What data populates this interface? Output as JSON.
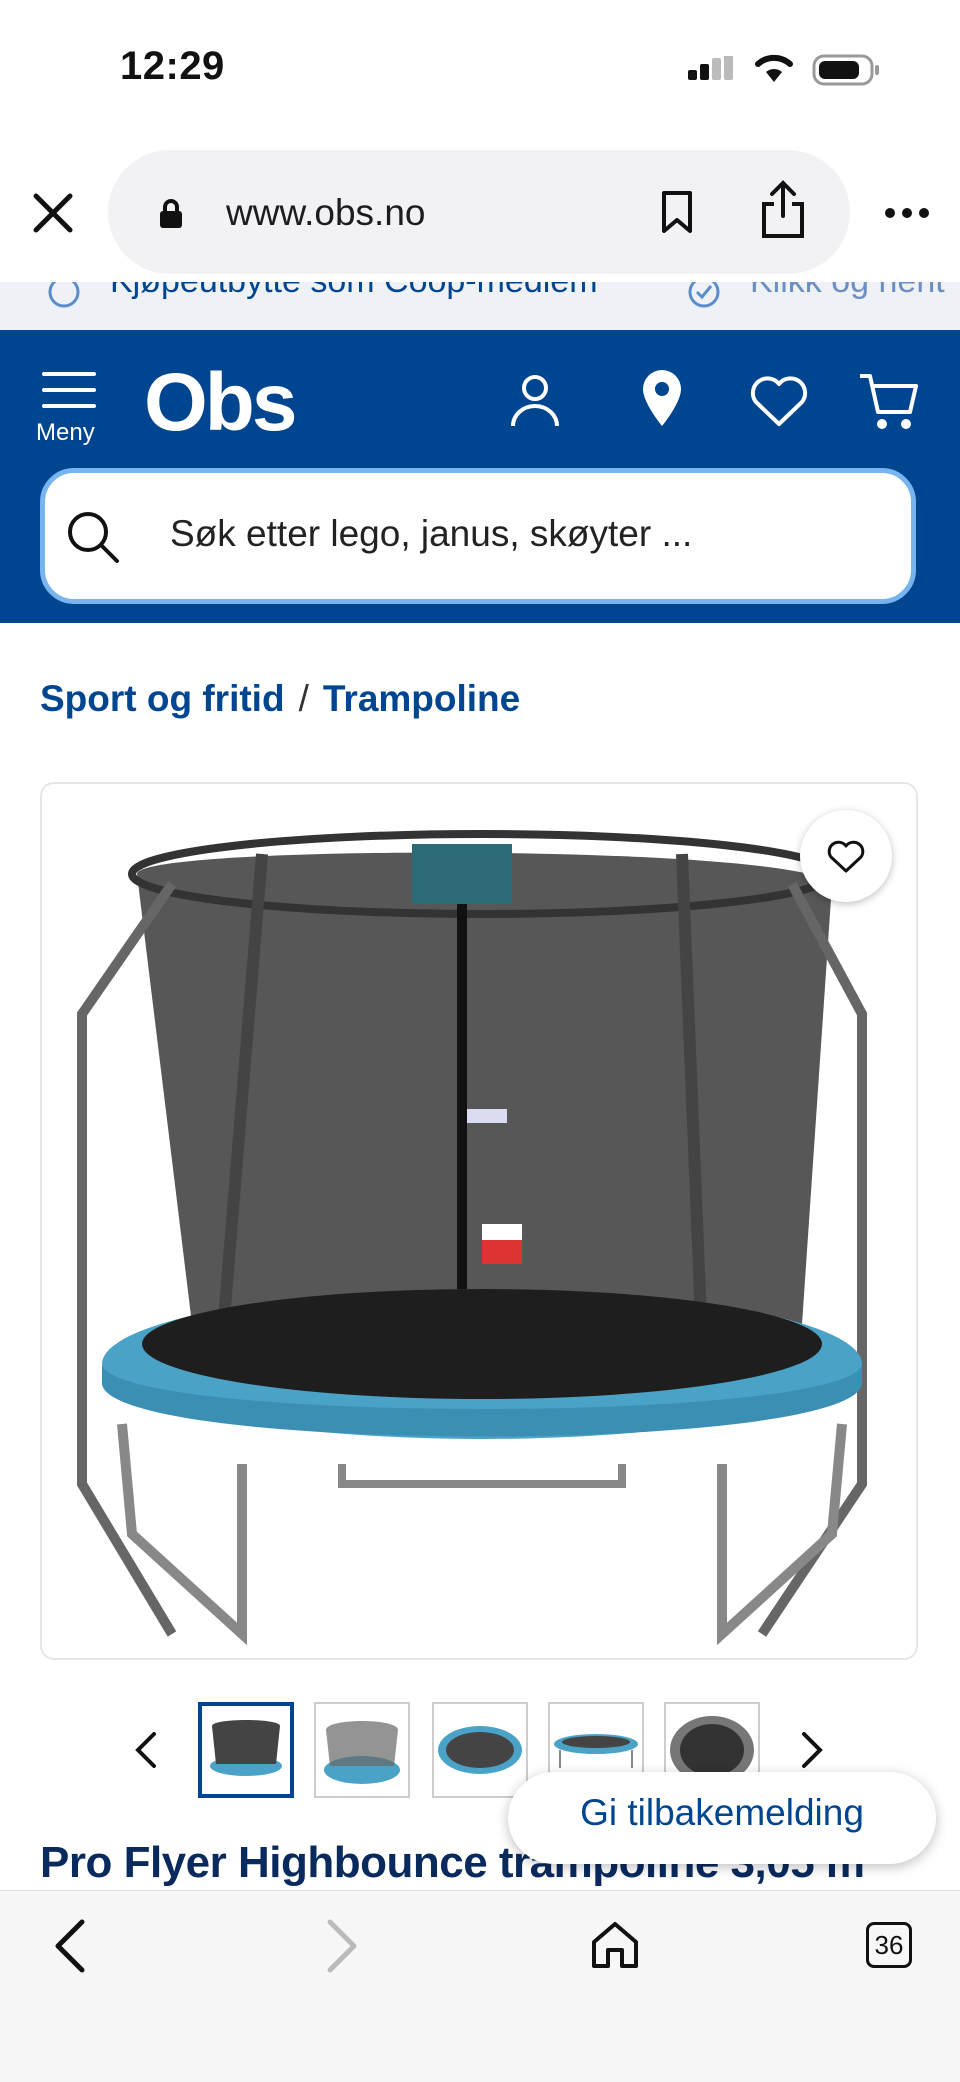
{
  "status_bar": {
    "time": "12:29"
  },
  "browser": {
    "url": "www.obs.no",
    "tabs_count": "36"
  },
  "promo": {
    "items": [
      "Kjøpeutbytte som Coop-medlem",
      "Klikk og hent"
    ]
  },
  "header": {
    "menu_label": "Meny",
    "logo_text": "Obs",
    "brand_color": "#00458f"
  },
  "search": {
    "placeholder": "Søk etter lego, janus, skøyter ..."
  },
  "breadcrumb": {
    "items": [
      "Sport og fritid",
      "Trampoline"
    ],
    "separator": "/"
  },
  "product": {
    "title": "Pro Flyer Highbounce trampoline 3,05 m",
    "thumbnail_count": 5,
    "selected_thumbnail": 1
  },
  "feedback": {
    "label": "Gi tilbakemelding"
  },
  "icons": [
    "close-icon",
    "lock-icon",
    "bookmark-icon",
    "share-icon",
    "more-icon",
    "menu-icon",
    "user-icon",
    "location-icon",
    "heart-icon",
    "cart-icon",
    "search-icon",
    "chevron-left-icon",
    "chevron-right-icon",
    "back-icon",
    "forward-icon",
    "home-icon",
    "tabs-icon"
  ]
}
